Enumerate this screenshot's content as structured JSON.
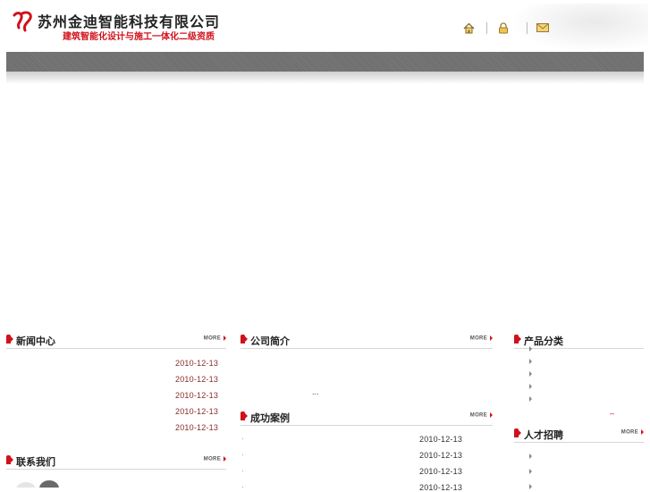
{
  "header": {
    "company_name": "苏州金迪智能科技有限公司",
    "tagline": "建筑智能化设计与施工一体化二级资质",
    "icons": [
      "home-icon",
      "lock-icon",
      "mail-icon"
    ]
  },
  "colors": {
    "accent": "#d0111b",
    "nav": "#707070",
    "date_red": "#8a2b2b"
  },
  "more_label": "MORE",
  "news": {
    "title": "新闻中心",
    "dates": [
      "2010-12-13",
      "2010-12-13",
      "2010-12-13",
      "2010-12-13",
      "2010-12-13"
    ]
  },
  "about": {
    "title": "公司简介",
    "ellipsis": "..."
  },
  "cases": {
    "title": "成功案例",
    "dates": [
      "2010-12-13",
      "2010-12-13",
      "2010-12-13",
      "2010-12-13"
    ]
  },
  "products": {
    "title": "产品分类",
    "dash": "–"
  },
  "jobs": {
    "title": "人才招聘"
  },
  "contact": {
    "title": "联系我们"
  }
}
